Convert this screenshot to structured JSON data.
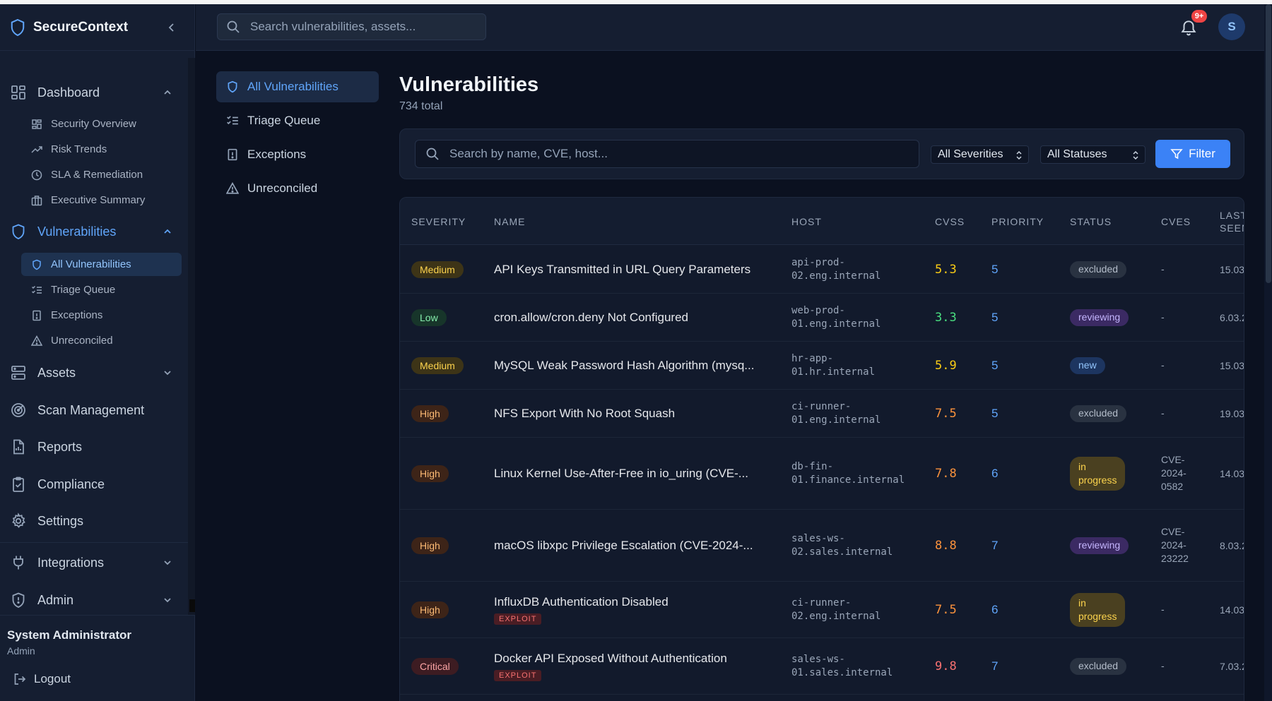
{
  "app": {
    "name": "SecureContext"
  },
  "sidebar": {
    "dashboard": {
      "label": "Dashboard",
      "items": [
        {
          "label": "Security Overview"
        },
        {
          "label": "Risk Trends"
        },
        {
          "label": "SLA & Remediation"
        },
        {
          "label": "Executive Summary"
        }
      ]
    },
    "vulnerabilities": {
      "label": "Vulnerabilities",
      "items": [
        {
          "label": "All Vulnerabilities"
        },
        {
          "label": "Triage Queue"
        },
        {
          "label": "Exceptions"
        },
        {
          "label": "Unreconciled"
        }
      ]
    },
    "assets": {
      "label": "Assets"
    },
    "scan_management": {
      "label": "Scan Management"
    },
    "reports": {
      "label": "Reports"
    },
    "compliance": {
      "label": "Compliance"
    },
    "settings": {
      "label": "Settings"
    },
    "integrations": {
      "label": "Integrations"
    },
    "admin": {
      "label": "Admin"
    },
    "user": {
      "name": "System Administrator",
      "role": "Admin"
    },
    "logout": "Logout"
  },
  "topbar": {
    "search_placeholder": "Search vulnerabilities, assets...",
    "notifications_badge": "9+",
    "avatar_initial": "S"
  },
  "subnav": [
    {
      "label": "All Vulnerabilities"
    },
    {
      "label": "Triage Queue"
    },
    {
      "label": "Exceptions"
    },
    {
      "label": "Unreconciled"
    }
  ],
  "page": {
    "title": "Vulnerabilities",
    "total": "734 total",
    "search_placeholder": "Search by name, CVE, host...",
    "severity_filter": "All Severities",
    "status_filter": "All Statuses",
    "filter_button": "Filter"
  },
  "table": {
    "columns": {
      "severity": "SEVERITY",
      "name": "NAME",
      "host": "HOST",
      "cvss": "CVSS",
      "priority": "PRIORITY",
      "status": "STATUS",
      "cves": "CVES",
      "last_seen": "LAST\nSEEN"
    },
    "rows": [
      {
        "severity": "Medium",
        "name": "API Keys Transmitted in URL Query Parameters",
        "exploit": "",
        "host": "api-prod-\n02.eng.internal",
        "cvss": "5.3",
        "priority": "5",
        "status": "excluded",
        "cves": "-",
        "last_seen": "15.03"
      },
      {
        "severity": "Low",
        "name": "cron.allow/cron.deny Not Configured",
        "exploit": "",
        "host": "web-prod-\n01.eng.internal",
        "cvss": "3.3",
        "priority": "5",
        "status": "reviewing",
        "cves": "-",
        "last_seen": "6.03.2"
      },
      {
        "severity": "Medium",
        "name": "MySQL Weak Password Hash Algorithm (mysq...",
        "exploit": "",
        "host": "hr-app-\n01.hr.internal",
        "cvss": "5.9",
        "priority": "5",
        "status": "new",
        "cves": "-",
        "last_seen": "15.03"
      },
      {
        "severity": "High",
        "name": "NFS Export With No Root Squash",
        "exploit": "",
        "host": "ci-runner-\n01.eng.internal",
        "cvss": "7.5",
        "priority": "5",
        "status": "excluded",
        "cves": "-",
        "last_seen": "19.03"
      },
      {
        "severity": "High",
        "name": "Linux Kernel Use-After-Free in io_uring (CVE-...",
        "exploit": "",
        "host": "db-fin-\n01.finance.internal",
        "cvss": "7.8",
        "priority": "6",
        "status": "in\nprogress",
        "cves": "CVE-\n2024-\n0582",
        "last_seen": "14.03"
      },
      {
        "severity": "High",
        "name": "macOS libxpc Privilege Escalation (CVE-2024-...",
        "exploit": "",
        "host": "sales-ws-\n02.sales.internal",
        "cvss": "8.8",
        "priority": "7",
        "status": "reviewing",
        "cves": "CVE-\n2024-\n23222",
        "last_seen": "8.03.2"
      },
      {
        "severity": "High",
        "name": "InfluxDB Authentication Disabled",
        "exploit": "EXPLOIT",
        "host": "ci-runner-\n02.eng.internal",
        "cvss": "7.5",
        "priority": "6",
        "status": "in\nprogress",
        "cves": "-",
        "last_seen": "14.03"
      },
      {
        "severity": "Critical",
        "name": "Docker API Exposed Without Authentication",
        "exploit": "EXPLOIT",
        "host": "sales-ws-\n01.sales.internal",
        "cvss": "9.8",
        "priority": "7",
        "status": "excluded",
        "cves": "-",
        "last_seen": "7.03.2"
      }
    ]
  }
}
